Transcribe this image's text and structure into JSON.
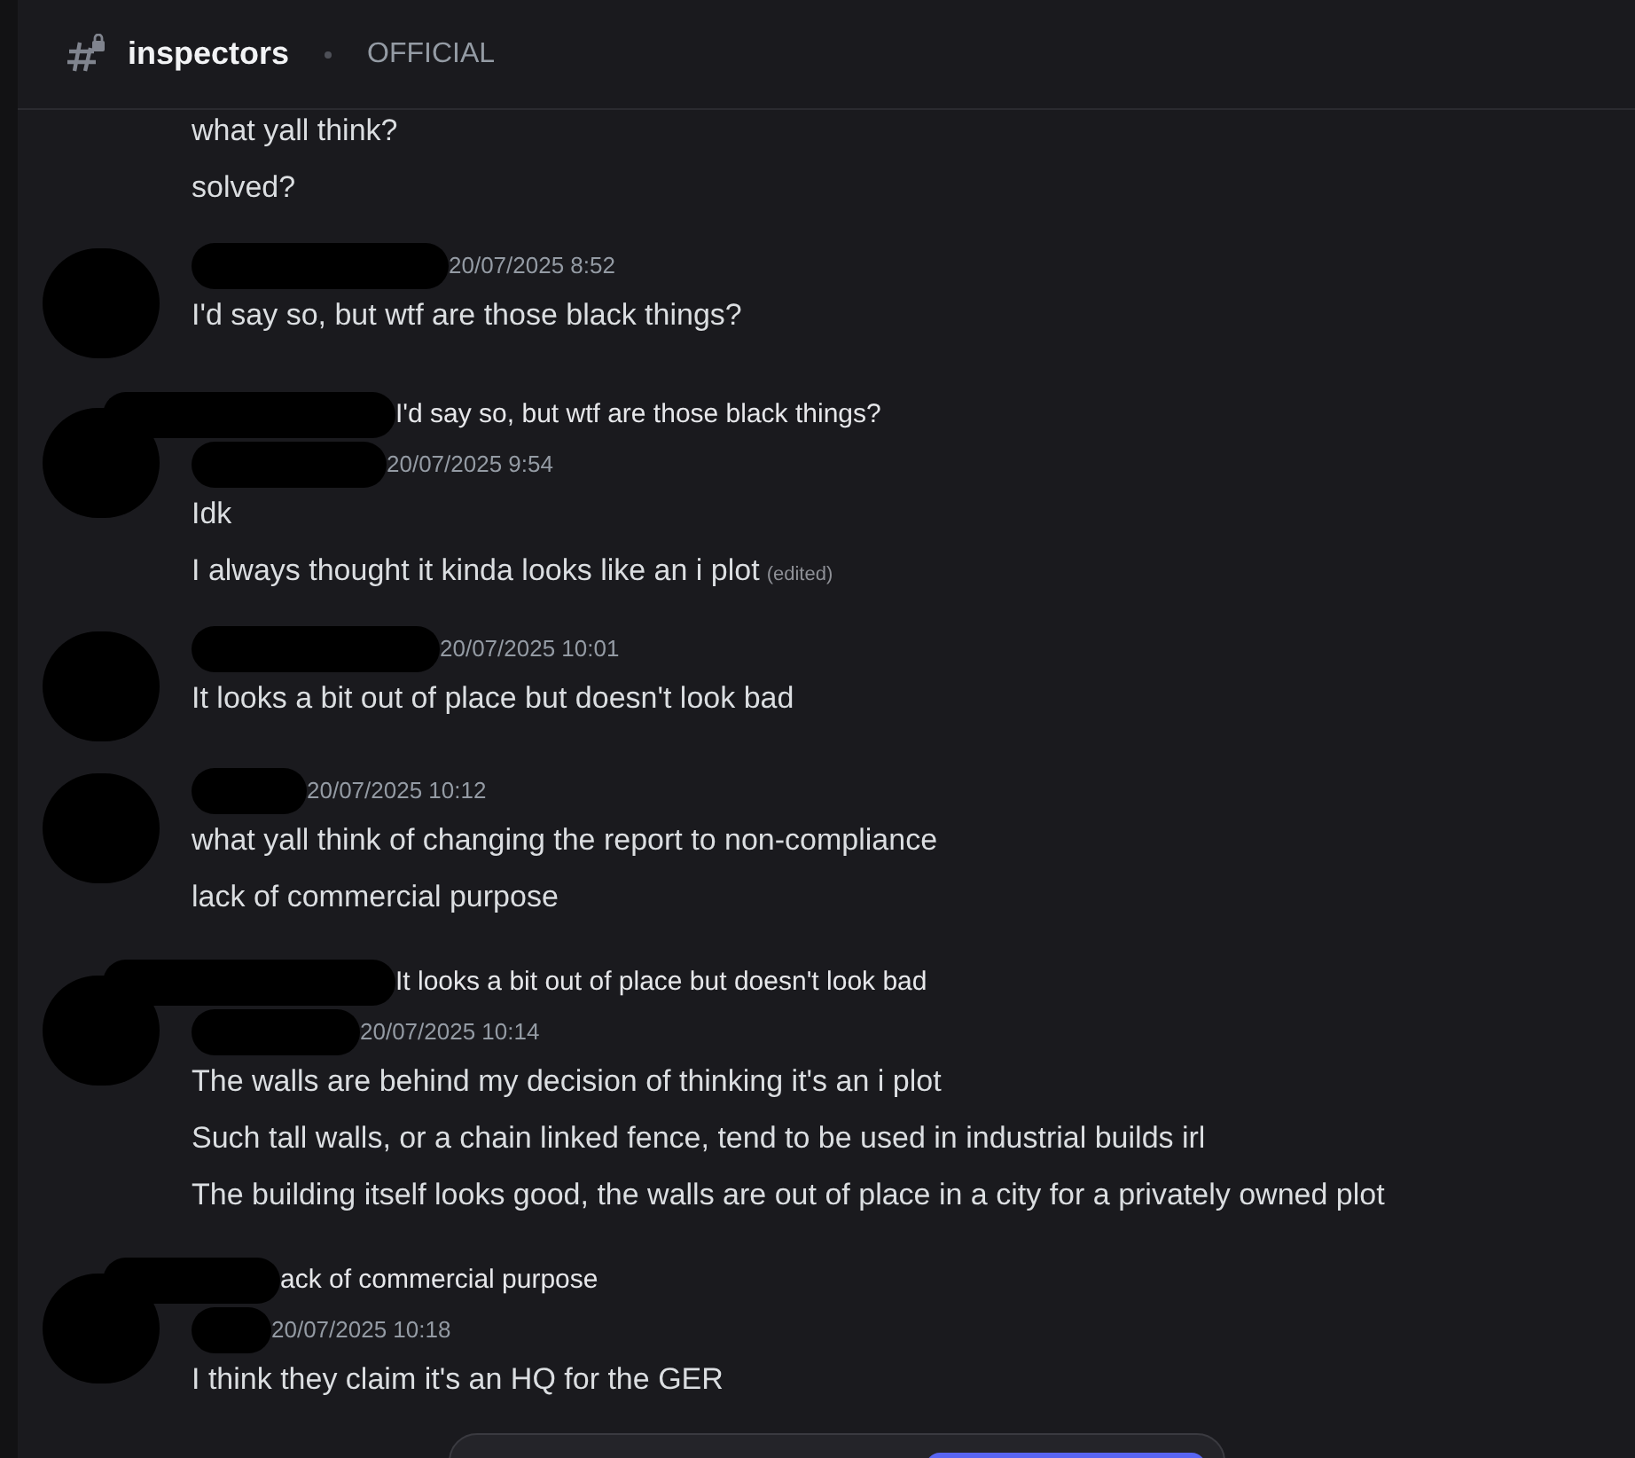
{
  "channel": {
    "name": "inspectors",
    "topic": "OFFICIAL"
  },
  "messages": [
    {
      "kind": "continuation",
      "lines": [
        {
          "text": "what yall think?"
        },
        {
          "text": "solved?"
        }
      ]
    },
    {
      "kind": "message",
      "timestamp": "20/07/2025 8:52",
      "lines": [
        {
          "text": "I'd say so, but wtf are those black things?"
        }
      ]
    },
    {
      "kind": "reply",
      "reply_to": "I'd say so, but wtf are those black things?",
      "timestamp": "20/07/2025 9:54",
      "lines": [
        {
          "text": "Idk"
        },
        {
          "text": "I always thought it kinda looks like an i plot",
          "edited_label": "(edited)"
        }
      ]
    },
    {
      "kind": "message",
      "timestamp": "20/07/2025 10:01",
      "lines": [
        {
          "text": "It looks a bit out of place but doesn't look bad"
        }
      ]
    },
    {
      "kind": "message",
      "timestamp": "20/07/2025 10:12",
      "lines": [
        {
          "text": "what yall think of changing the report to non-compliance"
        },
        {
          "text": "lack of commercial purpose"
        }
      ]
    },
    {
      "kind": "reply",
      "reply_to": "It looks a bit out of place but doesn't look bad",
      "timestamp": "20/07/2025 10:14",
      "lines": [
        {
          "text": "The walls are behind my decision of thinking it's an i plot"
        },
        {
          "text": "Such tall walls, or a chain linked fence, tend to be used in industrial builds irl"
        },
        {
          "text": "The building itself looks good, the walls are out of place in a city for a privately owned plot"
        }
      ]
    },
    {
      "kind": "reply",
      "reply_to": "ack of commercial purpose",
      "timestamp": "20/07/2025 10:18",
      "lines": [
        {
          "text": "I think they claim it's an HQ for the GER"
        }
      ]
    }
  ]
}
